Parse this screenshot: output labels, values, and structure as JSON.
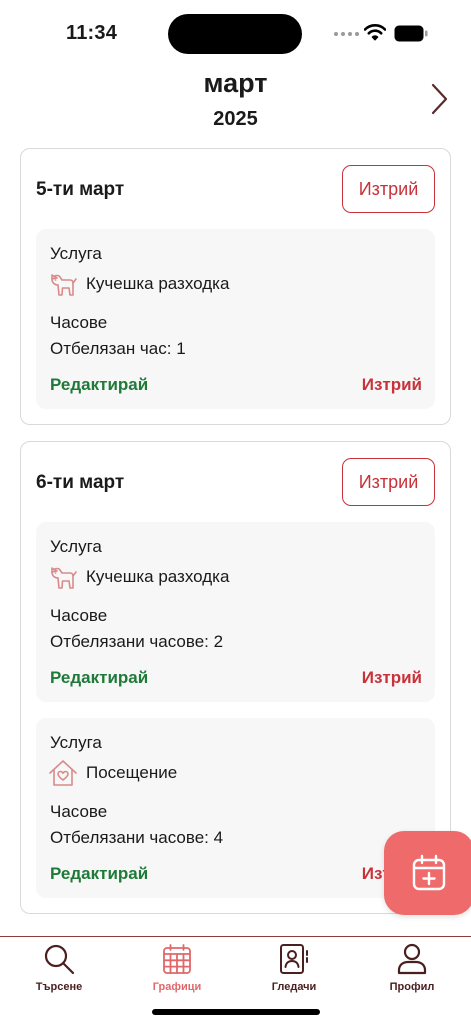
{
  "status_bar": {
    "time": "11:34"
  },
  "header": {
    "month": "март",
    "year": "2025"
  },
  "days": [
    {
      "title": "5-ти март",
      "delete_label": "Изтрий",
      "entries": [
        {
          "service_label": "Услуга",
          "service_name": "Кучешка разходка",
          "service_icon": "dog-icon",
          "hours_label": "Часове",
          "hours_value": "Отбелязан час: 1",
          "edit_label": "Редактирай",
          "delete_label": "Изтрий"
        }
      ]
    },
    {
      "title": "6-ти март",
      "delete_label": "Изтрий",
      "entries": [
        {
          "service_label": "Услуга",
          "service_name": "Кучешка разходка",
          "service_icon": "dog-icon",
          "hours_label": "Часове",
          "hours_value": "Отбелязани часове: 2",
          "edit_label": "Редактирай",
          "delete_label": "Изтрий"
        },
        {
          "service_label": "Услуга",
          "service_name": "Посещение",
          "service_icon": "house-heart-icon",
          "hours_label": "Часове",
          "hours_value": "Отбелязани часове: 4",
          "edit_label": "Редактирай",
          "delete_label": "Изтрий"
        }
      ]
    }
  ],
  "tabs": [
    {
      "label": "Търсене",
      "icon": "search-icon",
      "active": false
    },
    {
      "label": "Графици",
      "icon": "calendar-grid-icon",
      "active": true
    },
    {
      "label": "Гледачи",
      "icon": "contacts-book-icon",
      "active": false
    },
    {
      "label": "Профил",
      "icon": "person-icon",
      "active": false
    }
  ],
  "colors": {
    "accent": "#e0686a",
    "danger": "#c8323a",
    "success": "#1f7a3a",
    "fab": "#ef6b6b",
    "tab_text": "#4a1f1f"
  }
}
